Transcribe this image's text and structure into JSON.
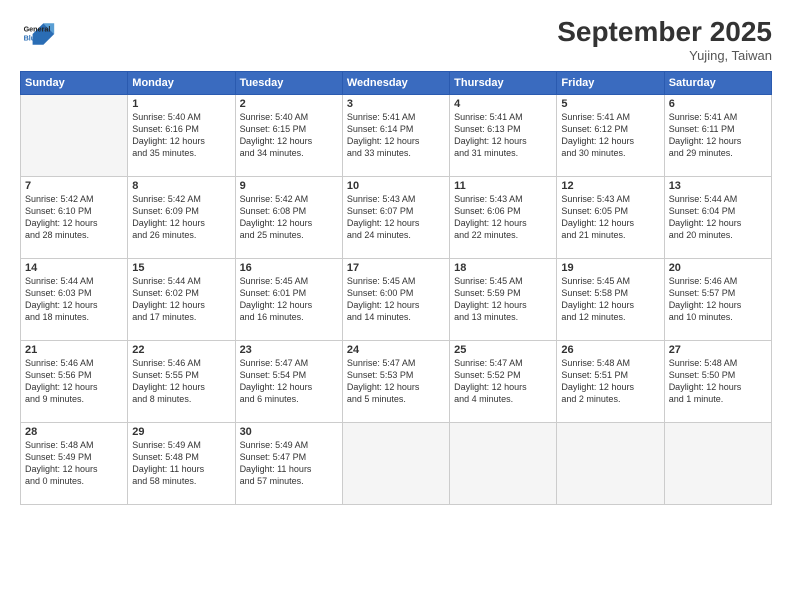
{
  "header": {
    "logo_line1": "General",
    "logo_line2": "Blue",
    "month_title": "September 2025",
    "location": "Yujing, Taiwan"
  },
  "weekdays": [
    "Sunday",
    "Monday",
    "Tuesday",
    "Wednesday",
    "Thursday",
    "Friday",
    "Saturday"
  ],
  "weeks": [
    [
      {
        "day": "",
        "info": ""
      },
      {
        "day": "1",
        "info": "Sunrise: 5:40 AM\nSunset: 6:16 PM\nDaylight: 12 hours\nand 35 minutes."
      },
      {
        "day": "2",
        "info": "Sunrise: 5:40 AM\nSunset: 6:15 PM\nDaylight: 12 hours\nand 34 minutes."
      },
      {
        "day": "3",
        "info": "Sunrise: 5:41 AM\nSunset: 6:14 PM\nDaylight: 12 hours\nand 33 minutes."
      },
      {
        "day": "4",
        "info": "Sunrise: 5:41 AM\nSunset: 6:13 PM\nDaylight: 12 hours\nand 31 minutes."
      },
      {
        "day": "5",
        "info": "Sunrise: 5:41 AM\nSunset: 6:12 PM\nDaylight: 12 hours\nand 30 minutes."
      },
      {
        "day": "6",
        "info": "Sunrise: 5:41 AM\nSunset: 6:11 PM\nDaylight: 12 hours\nand 29 minutes."
      }
    ],
    [
      {
        "day": "7",
        "info": "Sunrise: 5:42 AM\nSunset: 6:10 PM\nDaylight: 12 hours\nand 28 minutes."
      },
      {
        "day": "8",
        "info": "Sunrise: 5:42 AM\nSunset: 6:09 PM\nDaylight: 12 hours\nand 26 minutes."
      },
      {
        "day": "9",
        "info": "Sunrise: 5:42 AM\nSunset: 6:08 PM\nDaylight: 12 hours\nand 25 minutes."
      },
      {
        "day": "10",
        "info": "Sunrise: 5:43 AM\nSunset: 6:07 PM\nDaylight: 12 hours\nand 24 minutes."
      },
      {
        "day": "11",
        "info": "Sunrise: 5:43 AM\nSunset: 6:06 PM\nDaylight: 12 hours\nand 22 minutes."
      },
      {
        "day": "12",
        "info": "Sunrise: 5:43 AM\nSunset: 6:05 PM\nDaylight: 12 hours\nand 21 minutes."
      },
      {
        "day": "13",
        "info": "Sunrise: 5:44 AM\nSunset: 6:04 PM\nDaylight: 12 hours\nand 20 minutes."
      }
    ],
    [
      {
        "day": "14",
        "info": "Sunrise: 5:44 AM\nSunset: 6:03 PM\nDaylight: 12 hours\nand 18 minutes."
      },
      {
        "day": "15",
        "info": "Sunrise: 5:44 AM\nSunset: 6:02 PM\nDaylight: 12 hours\nand 17 minutes."
      },
      {
        "day": "16",
        "info": "Sunrise: 5:45 AM\nSunset: 6:01 PM\nDaylight: 12 hours\nand 16 minutes."
      },
      {
        "day": "17",
        "info": "Sunrise: 5:45 AM\nSunset: 6:00 PM\nDaylight: 12 hours\nand 14 minutes."
      },
      {
        "day": "18",
        "info": "Sunrise: 5:45 AM\nSunset: 5:59 PM\nDaylight: 12 hours\nand 13 minutes."
      },
      {
        "day": "19",
        "info": "Sunrise: 5:45 AM\nSunset: 5:58 PM\nDaylight: 12 hours\nand 12 minutes."
      },
      {
        "day": "20",
        "info": "Sunrise: 5:46 AM\nSunset: 5:57 PM\nDaylight: 12 hours\nand 10 minutes."
      }
    ],
    [
      {
        "day": "21",
        "info": "Sunrise: 5:46 AM\nSunset: 5:56 PM\nDaylight: 12 hours\nand 9 minutes."
      },
      {
        "day": "22",
        "info": "Sunrise: 5:46 AM\nSunset: 5:55 PM\nDaylight: 12 hours\nand 8 minutes."
      },
      {
        "day": "23",
        "info": "Sunrise: 5:47 AM\nSunset: 5:54 PM\nDaylight: 12 hours\nand 6 minutes."
      },
      {
        "day": "24",
        "info": "Sunrise: 5:47 AM\nSunset: 5:53 PM\nDaylight: 12 hours\nand 5 minutes."
      },
      {
        "day": "25",
        "info": "Sunrise: 5:47 AM\nSunset: 5:52 PM\nDaylight: 12 hours\nand 4 minutes."
      },
      {
        "day": "26",
        "info": "Sunrise: 5:48 AM\nSunset: 5:51 PM\nDaylight: 12 hours\nand 2 minutes."
      },
      {
        "day": "27",
        "info": "Sunrise: 5:48 AM\nSunset: 5:50 PM\nDaylight: 12 hours\nand 1 minute."
      }
    ],
    [
      {
        "day": "28",
        "info": "Sunrise: 5:48 AM\nSunset: 5:49 PM\nDaylight: 12 hours\nand 0 minutes."
      },
      {
        "day": "29",
        "info": "Sunrise: 5:49 AM\nSunset: 5:48 PM\nDaylight: 11 hours\nand 58 minutes."
      },
      {
        "day": "30",
        "info": "Sunrise: 5:49 AM\nSunset: 5:47 PM\nDaylight: 11 hours\nand 57 minutes."
      },
      {
        "day": "",
        "info": ""
      },
      {
        "day": "",
        "info": ""
      },
      {
        "day": "",
        "info": ""
      },
      {
        "day": "",
        "info": ""
      }
    ]
  ]
}
